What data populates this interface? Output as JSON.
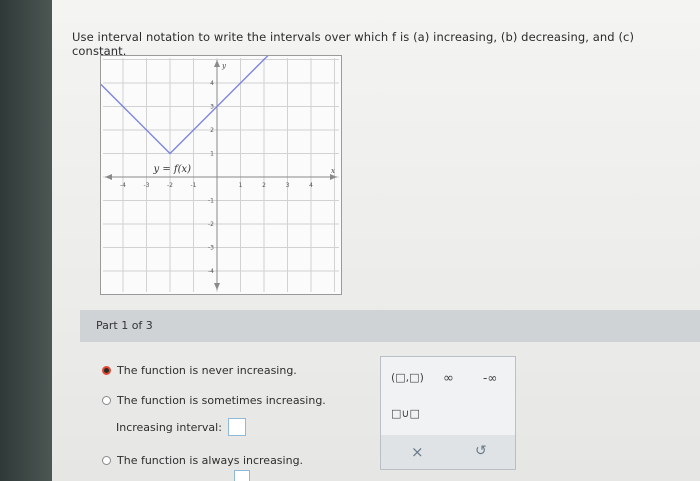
{
  "question": {
    "text": "Use interval notation to write the intervals over which f is (a) increasing, (b) decreasing, and (c) constant."
  },
  "graph": {
    "function_label": "y = f(x)",
    "x_axis_label": "x",
    "y_axis_label": "y",
    "x_ticks": [
      "-4",
      "-3",
      "-2",
      "-1",
      "1",
      "2",
      "3",
      "4"
    ],
    "y_ticks": [
      "4",
      "3",
      "2",
      "1",
      "-1",
      "-2",
      "-3",
      "-4"
    ]
  },
  "part": {
    "label": "Part 1 of 3"
  },
  "options": [
    {
      "label": "The function is never increasing.",
      "selected": true
    },
    {
      "label": "The function is sometimes increasing.",
      "selected": false
    },
    {
      "label": "The function is always increasing.",
      "selected": false
    }
  ],
  "increasing_interval": {
    "label": "Increasing interval:",
    "value": ""
  },
  "palette": {
    "interval_button": "(□,□)",
    "infinity_button": "∞",
    "neg_infinity_button": "-∞",
    "union_button": "□∪□",
    "clear_button": "×",
    "undo_button": "↺"
  },
  "colors": {
    "function_line": "#7b86e0",
    "radio_selected": "#e04a2f",
    "part_bar": "#cfd3d6"
  }
}
